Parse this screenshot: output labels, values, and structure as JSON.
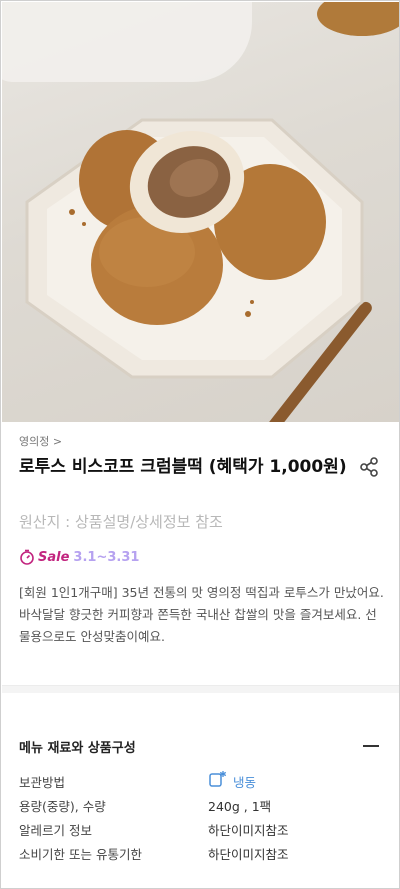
{
  "product": {
    "brand_link": "영의정 >",
    "title": "로투스 비스코프 크럼블떡 (혜택가 1,000원)",
    "origin": "원산지 : 상품설명/상세정보 참조",
    "sale": {
      "label": "Sale",
      "period": "3.1~3.31"
    },
    "description": "[회원 1인1개구매] 35년 전통의 맛 영의정 떡집과 로투스가 만났어요. 바삭달달 향긋한 커피향과 쫀득한 국내산 찹쌀의 맛을 즐겨보세요. 선물용으로도 안성맞춤이예요."
  },
  "menu_section": {
    "title": "메뉴 재료와 상품구성",
    "rows": [
      {
        "label": "보관방법",
        "value": "냉동"
      },
      {
        "label": "용량(중량), 수량",
        "value": "240g , 1팩"
      },
      {
        "label": "알레르기 정보",
        "value": "하단이미지참조"
      },
      {
        "label": "소비기한 또는 유통기한",
        "value": "하단이미지참조"
      }
    ]
  },
  "icons": {
    "share": "share-icon",
    "sale": "timer-icon",
    "storage": "freezer-icon",
    "collapse": "minus-icon"
  },
  "colors": {
    "sale_label": "#c2257f",
    "sale_period": "#b6a2f0",
    "frozen": "#4a8fd9"
  }
}
